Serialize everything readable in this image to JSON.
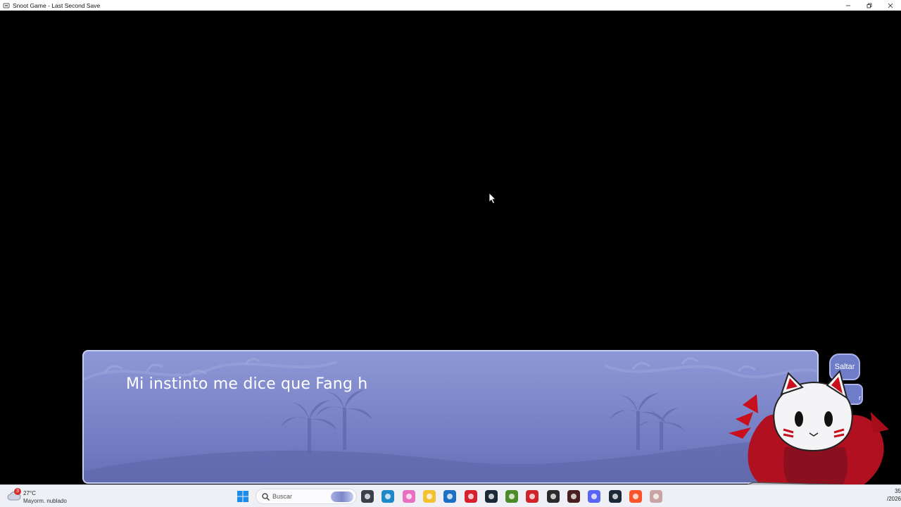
{
  "window": {
    "title": "Snoot Game - Last Second Save",
    "controls": [
      "minimize-icon",
      "restore-icon",
      "close-icon"
    ]
  },
  "dialogue": {
    "text": "Mi instinto me dice que Fang h"
  },
  "skip_button": {
    "label": "Saltar"
  },
  "second_button": {
    "label_fragment": "r"
  },
  "taskbar": {
    "weather": {
      "badge": "3",
      "temperature": "27°C",
      "condition": "Mayorm. nublado"
    },
    "search": {
      "placeholder": "Buscar"
    },
    "apps": [
      {
        "name": "file-manager-icon",
        "color": "#3a3f4a"
      },
      {
        "name": "edge-icon",
        "color": "#1e88c8"
      },
      {
        "name": "copilot-icon",
        "color": "#e86fc2"
      },
      {
        "name": "folder-icon",
        "color": "#f2c230"
      },
      {
        "name": "store-icon",
        "color": "#1c6fc2"
      },
      {
        "name": "opera-icon",
        "color": "#d6202d"
      },
      {
        "name": "steam-icon",
        "color": "#1b2838"
      },
      {
        "name": "minecraft-icon",
        "color": "#4b8b2a"
      },
      {
        "name": "wps-icon",
        "color": "#d0242b"
      },
      {
        "name": "obs-icon",
        "color": "#2b2b2b"
      },
      {
        "name": "game-icon",
        "color": "#4a1f1f"
      },
      {
        "name": "discord-icon",
        "color": "#5865f2"
      },
      {
        "name": "steam-icon-2",
        "color": "#1b2838"
      },
      {
        "name": "brave-icon",
        "color": "#fb542b"
      },
      {
        "name": "snoot-game-icon",
        "color": "#c8a4a4"
      }
    ],
    "clock": {
      "time": "35",
      "date": "/2026"
    }
  },
  "colors": {
    "dialogue_top": "#8e98d6",
    "dialogue_bottom": "#6770b6",
    "dialogue_border": "#c8cff4",
    "mascot_red": "#b01020"
  }
}
